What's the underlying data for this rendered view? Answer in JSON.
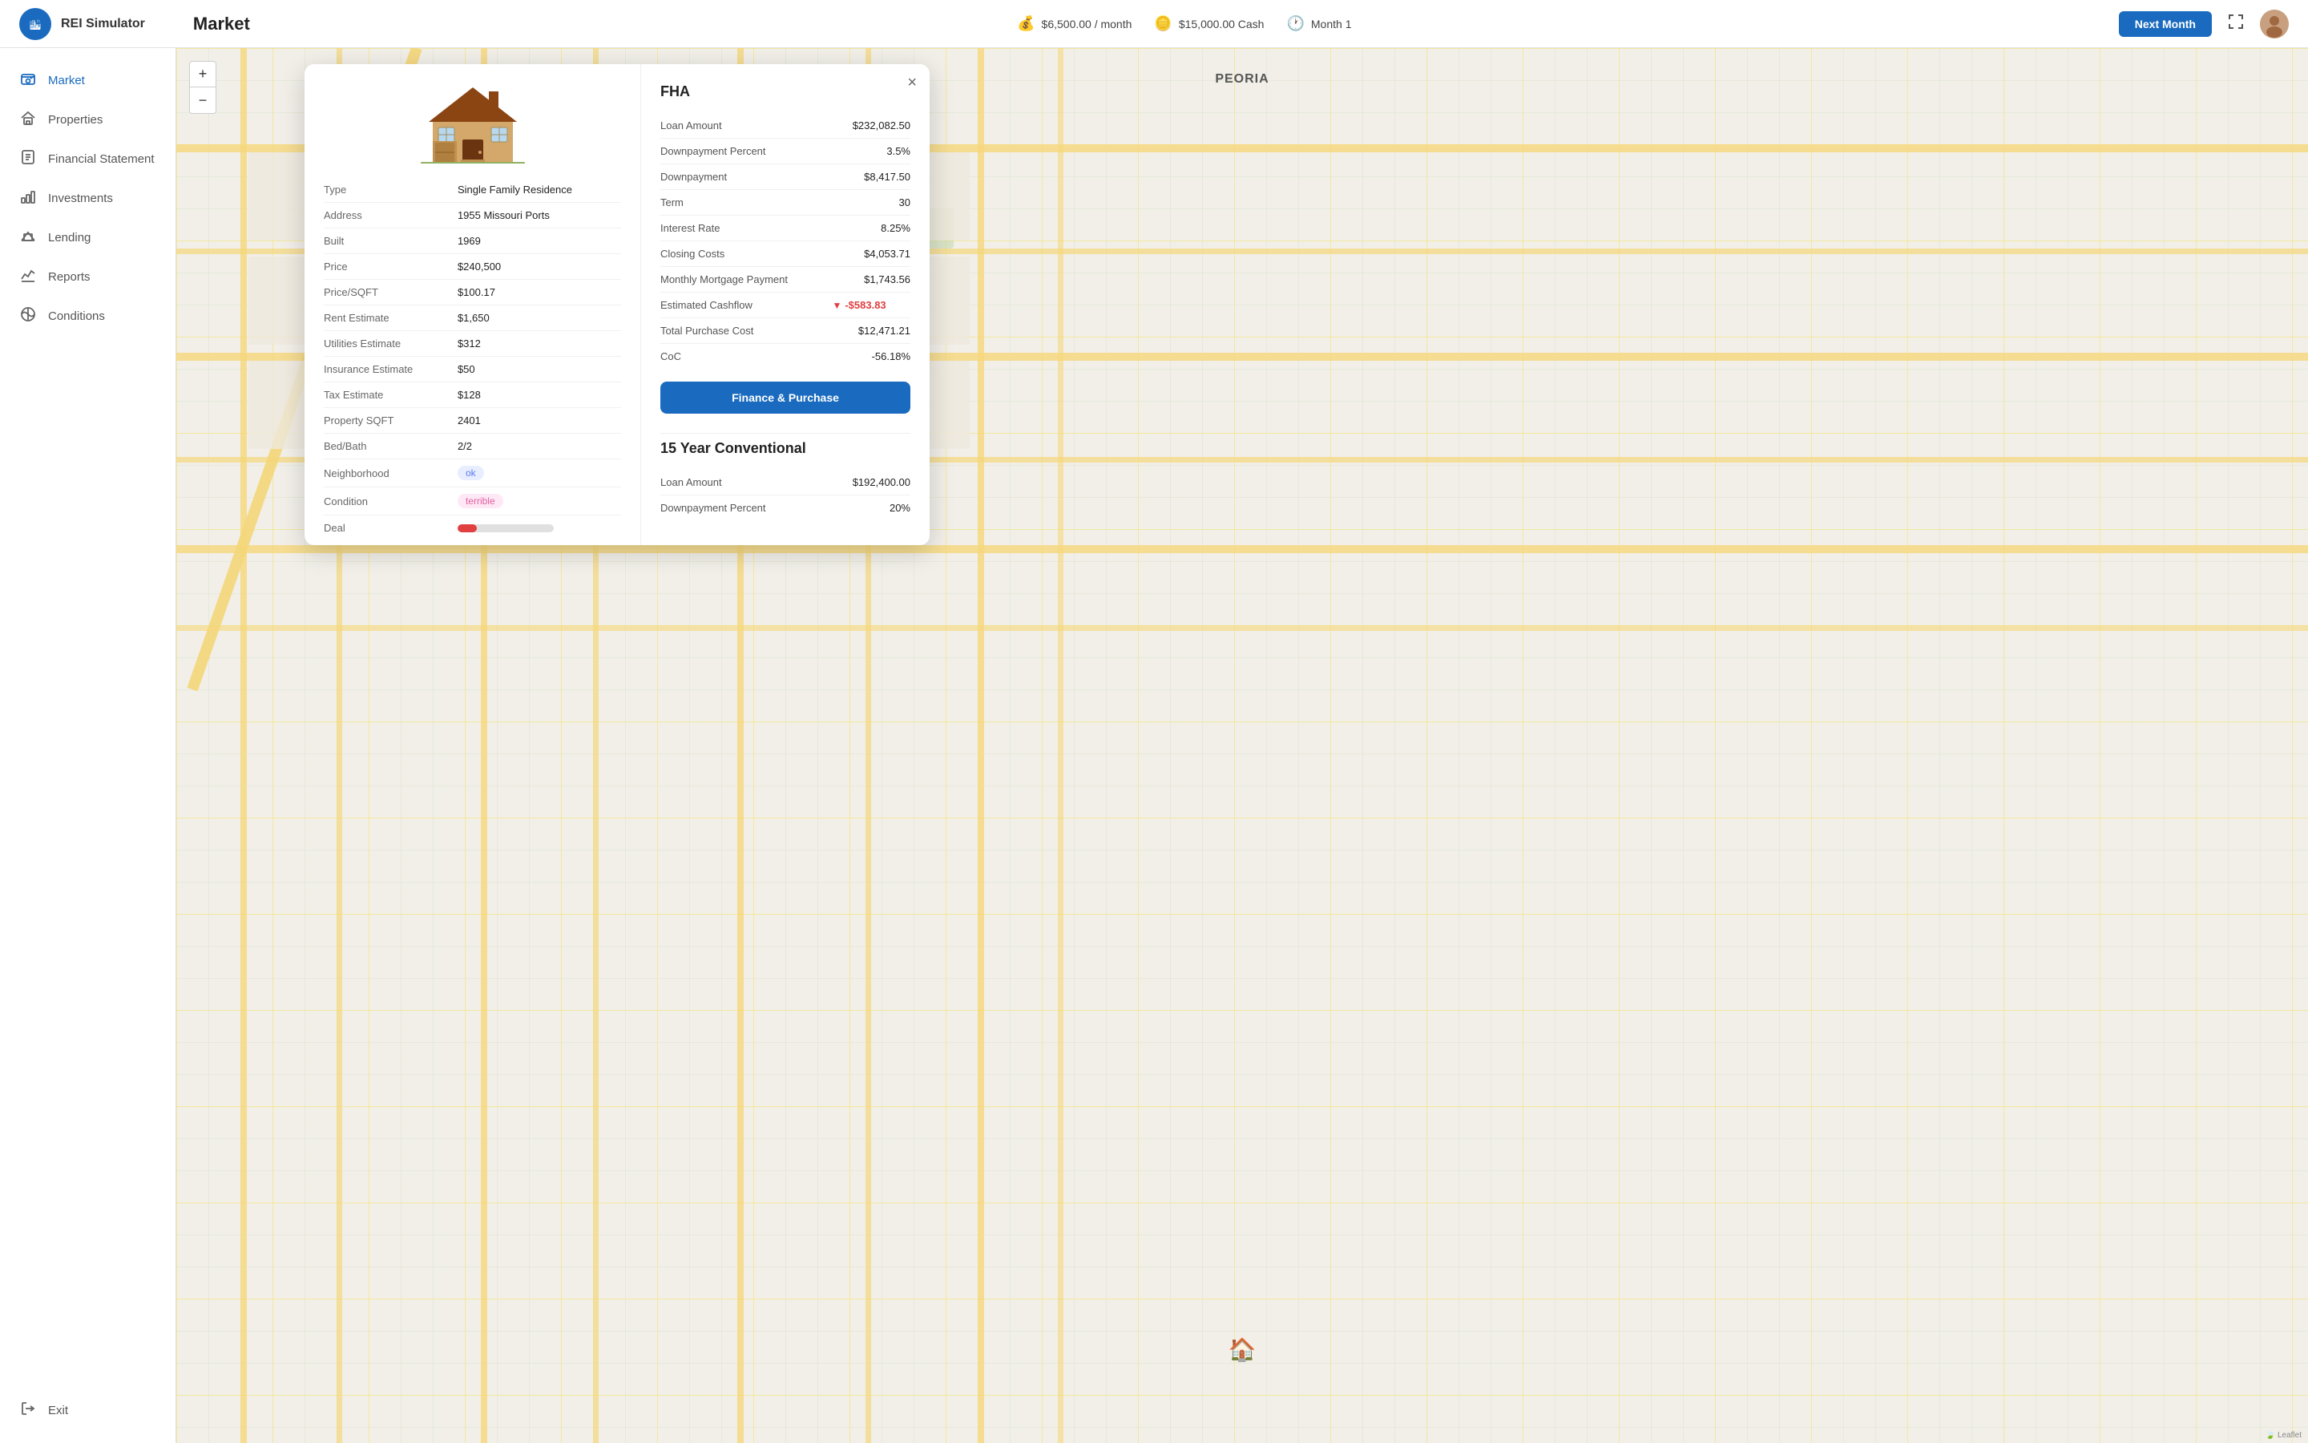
{
  "app": {
    "name": "REI Simulator",
    "logo_char": "🏙"
  },
  "header": {
    "page_title": "Market",
    "income_label": "$6,500.00 / month",
    "cash_label": "$15,000.00 Cash",
    "month_label": "Month 1",
    "next_month_label": "Next Month",
    "income_icon": "💰",
    "cash_icon": "💰",
    "month_icon": "🕐"
  },
  "sidebar": {
    "items": [
      {
        "id": "market",
        "label": "Market",
        "icon": "🗺",
        "active": true
      },
      {
        "id": "properties",
        "label": "Properties",
        "icon": "🏠"
      },
      {
        "id": "financial-statement",
        "label": "Financial Statement",
        "icon": "📄"
      },
      {
        "id": "investments",
        "label": "Investments",
        "icon": "📊"
      },
      {
        "id": "lending",
        "label": "Lending",
        "icon": "🏛"
      },
      {
        "id": "reports",
        "label": "Reports",
        "icon": "📈"
      },
      {
        "id": "conditions",
        "label": "Conditions",
        "icon": "🌐"
      }
    ],
    "exit_label": "Exit",
    "exit_icon": "🚪"
  },
  "map": {
    "city_label": "PEORIA",
    "zoom_in": "+",
    "zoom_out": "−",
    "attribution": "🍃 Leaflet"
  },
  "property": {
    "type_label": "Type",
    "type_value": "Single Family Residence",
    "address_label": "Address",
    "address_value": "1955 Missouri Ports",
    "built_label": "Built",
    "built_value": "1969",
    "price_label": "Price",
    "price_value": "$240,500",
    "price_sqft_label": "Price/SQFT",
    "price_sqft_value": "$100.17",
    "rent_label": "Rent Estimate",
    "rent_value": "$1,650",
    "utilities_label": "Utilities Estimate",
    "utilities_value": "$312",
    "insurance_label": "Insurance Estimate",
    "insurance_value": "$50",
    "tax_label": "Tax Estimate",
    "tax_value": "$128",
    "sqft_label": "Property SQFT",
    "sqft_value": "2401",
    "bedbath_label": "Bed/Bath",
    "bedbath_value": "2/2",
    "neighborhood_label": "Neighborhood",
    "neighborhood_value": "ok",
    "condition_label": "Condition",
    "condition_value": "terrible",
    "deal_label": "Deal"
  },
  "fha": {
    "title": "FHA",
    "loan_amount_label": "Loan Amount",
    "loan_amount_value": "$232,082.50",
    "down_percent_label": "Downpayment Percent",
    "down_percent_value": "3.5%",
    "down_label": "Downpayment",
    "down_value": "$8,417.50",
    "term_label": "Term",
    "term_value": "30",
    "interest_label": "Interest Rate",
    "interest_value": "8.25%",
    "closing_label": "Closing Costs",
    "closing_value": "$4,053.71",
    "monthly_payment_label": "Monthly Mortgage Payment",
    "monthly_payment_value": "$1,743.56",
    "cashflow_label": "Estimated Cashflow",
    "cashflow_value": "-$583.83",
    "total_purchase_label": "Total Purchase Cost",
    "total_purchase_value": "$12,471.21",
    "coc_label": "CoC",
    "coc_value": "-56.18%",
    "finance_btn": "Finance & Purchase"
  },
  "conventional15": {
    "title": "15 Year Conventional",
    "loan_amount_label": "Loan Amount",
    "loan_amount_value": "$192,400.00",
    "down_percent_label": "Downpayment Percent",
    "down_percent_value": "20%"
  }
}
